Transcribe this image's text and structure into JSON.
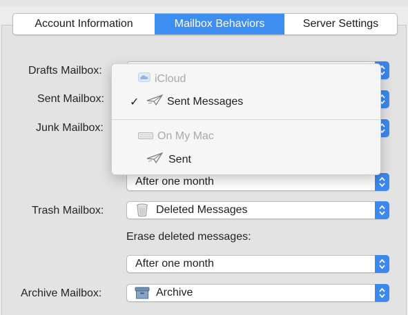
{
  "tabs": [
    {
      "label": "Account Information",
      "active": false
    },
    {
      "label": "Mailbox Behaviors",
      "active": true
    },
    {
      "label": "Server Settings",
      "active": false
    }
  ],
  "form": {
    "drafts_label": "Drafts Mailbox:",
    "sent_label": "Sent Mailbox:",
    "junk_label": "Junk Mailbox:",
    "junk_erase_value": "After one month",
    "trash_label": "Trash Mailbox:",
    "trash_value": "Deleted Messages",
    "erase_deleted_label": "Erase deleted messages:",
    "erase_deleted_value": "After one month",
    "archive_label": "Archive Mailbox:",
    "archive_value": "Archive"
  },
  "dropdown_menu": {
    "section1_header": "iCloud",
    "section1_item": "Sent Messages",
    "checkmark": "✓",
    "section2_header": "On My Mac",
    "section2_item": "Sent"
  },
  "colors": {
    "accent": "#3d8ef1",
    "stepper": "#3b88ee",
    "background": "#ececec"
  }
}
